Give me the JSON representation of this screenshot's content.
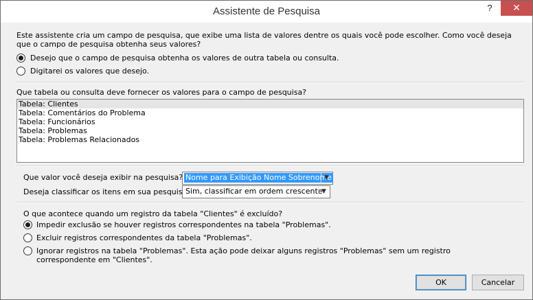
{
  "window": {
    "title": "Assistente de Pesquisa",
    "help_glyph": "?",
    "close_glyph": "✕"
  },
  "intro": {
    "text": "Este assistente cria um campo de pesquisa, que exibe uma lista de valores dentre os quais você pode escolher. Como você deseja que o campo de pesquisa obtenha seus valores?",
    "options": [
      {
        "label": "Desejo que o campo de pesquisa obtenha os valores de outra tabela ou consulta.",
        "selected": true
      },
      {
        "label": "Digitarei os valores que desejo.",
        "selected": false
      }
    ]
  },
  "source": {
    "question": "Que tabela ou consulta deve fornecer os valores para o campo de pesquisa?",
    "items": [
      "Tabela: Clientes",
      "Tabela: Comentários do Problema",
      "Tabela: Funcionários",
      "Tabela: Problemas",
      "Tabela: Problemas Relacionados"
    ],
    "selected_index": 0
  },
  "display": {
    "label": "Que valor você deseja exibir na pesquisa?",
    "value": "Nome para Exibição Nome Sobrenome"
  },
  "sort": {
    "label": "Deseja classificar os itens em sua pesquisa?",
    "value": "Sim, classificar em ordem crescente"
  },
  "delete": {
    "question": "O que acontece quando um registro da tabela \"Clientes\" é excluído?",
    "options": [
      {
        "label": "Impedir exclusão se houver registros correspondentes na tabela \"Problemas\".",
        "selected": true
      },
      {
        "label": "Excluir registros correspondentes da tabela \"Problemas\".",
        "selected": false
      },
      {
        "label": "Ignorar registros na tabela \"Problemas\". Esta ação pode deixar alguns registros \"Problemas\" sem um registro correspondente em \"Clientes\".",
        "selected": false
      }
    ]
  },
  "buttons": {
    "ok": "OK",
    "cancel": "Cancelar"
  }
}
